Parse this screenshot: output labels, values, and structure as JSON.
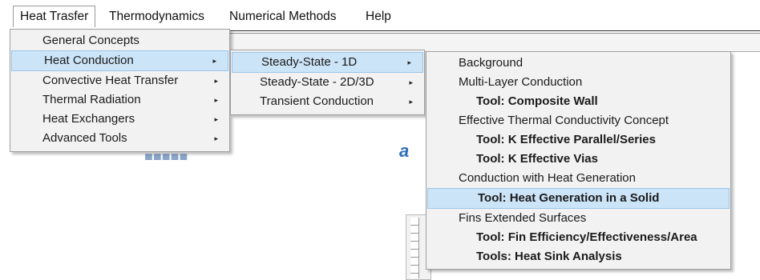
{
  "menubar": {
    "items": [
      "Heat Trasfer",
      "Thermodynamics",
      "Numerical Methods",
      "Help"
    ]
  },
  "menu_heat_transfer": {
    "items": [
      "General Concepts",
      "Heat Conduction",
      "Convective Heat Transfer",
      "Thermal Radiation",
      "Heat Exchangers",
      "Advanced Tools"
    ]
  },
  "menu_heat_conduction": {
    "items": [
      "Steady-State - 1D",
      "Steady-State - 2D/3D",
      "Transient Conduction"
    ]
  },
  "menu_steady_1d": {
    "items": [
      "Background",
      "Multi-Layer Conduction",
      "Tool: Composite Wall",
      "Effective Thermal Conductivity Concept",
      "Tool: K Effective Parallel/Series",
      "Tool: K Effective Vias",
      "Conduction with Heat Generation",
      "Tool: Heat Generation in a Solid",
      "Fins  Extended Surfaces",
      "Tool: Fin Efficiency/Effectiveness/Area",
      "Tools: Heat Sink Analysis"
    ]
  },
  "icons": {
    "submenu_arrow": "▸",
    "arrow_icon_name": "chevron-right-icon"
  },
  "colors": {
    "highlight": "#cce4f7",
    "highlight_border": "#99c5ea",
    "menu_bg": "#f2f2f2"
  }
}
